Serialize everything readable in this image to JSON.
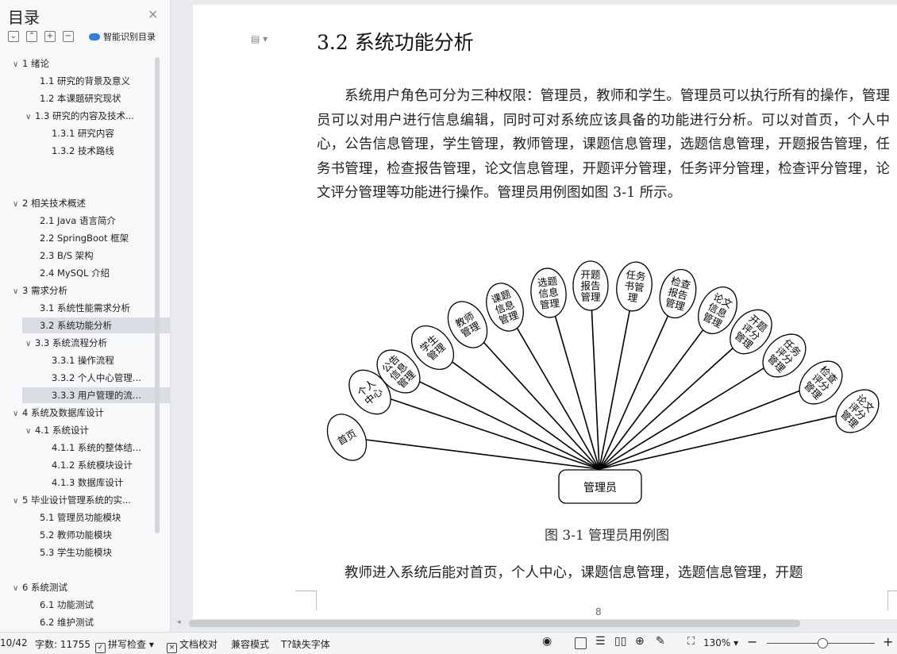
{
  "sidebar": {
    "title": "目录",
    "close": "×",
    "tool_icons": [
      "⌄",
      "⌃",
      "+",
      "−"
    ],
    "smart_label": "智能识别目录",
    "items": [
      {
        "text": "1 绪论",
        "level": 0,
        "arrow": "∨"
      },
      {
        "text": "1.1 研究的背景及意义",
        "level": 1
      },
      {
        "text": "1.2 本课题研究现状",
        "level": 1
      },
      {
        "text": "1.3 研究的内容及技术...",
        "level": 1,
        "arrow": "∨"
      },
      {
        "text": "1.3.1 研究内容",
        "level": 2
      },
      {
        "text": "1.3.2 技术路线",
        "level": 2
      },
      {
        "text": "2 相关技术概述",
        "level": 0,
        "arrow": "∨"
      },
      {
        "text": "2.1 Java 语言简介",
        "level": 1
      },
      {
        "text": "2.2 SpringBoot 框架",
        "level": 1
      },
      {
        "text": "2.3 B/S 架构",
        "level": 1
      },
      {
        "text": "2.4 MySQL 介绍",
        "level": 1
      },
      {
        "text": "3 需求分析",
        "level": 0,
        "arrow": "∨"
      },
      {
        "text": "3.1 系统性能需求分析",
        "level": 1
      },
      {
        "text": "3.2 系统功能分析",
        "level": 1,
        "selected": true
      },
      {
        "text": "3.3 系统流程分析",
        "level": 1,
        "arrow": "∨"
      },
      {
        "text": "3.3.1 操作流程",
        "level": 2
      },
      {
        "text": "3.3.2 个人中心管理...",
        "level": 2
      },
      {
        "text": "3.3.3 用户管理的流...",
        "level": 2,
        "selected": true
      },
      {
        "text": "4 系统及数据库设计",
        "level": 0,
        "arrow": "∨"
      },
      {
        "text": "4.1 系统设计",
        "level": 1,
        "arrow": "∨"
      },
      {
        "text": "4.1.1 系统的整体结...",
        "level": 2
      },
      {
        "text": "4.1.2 系统模块设计",
        "level": 2
      },
      {
        "text": "4.1.3 数据库设计",
        "level": 2
      },
      {
        "text": "5 毕业设计管理系统的实...",
        "level": 0,
        "arrow": "∨"
      },
      {
        "text": "5.1 管理员功能模块",
        "level": 1
      },
      {
        "text": "5.2 教师功能模块",
        "level": 1
      },
      {
        "text": "5.3 学生功能模块",
        "level": 1
      },
      {
        "text": "6 系统测试",
        "level": 0,
        "arrow": "∨"
      },
      {
        "text": "6.1 功能测试",
        "level": 1
      },
      {
        "text": "6.2 维护测试",
        "level": 1
      }
    ]
  },
  "document": {
    "page_icon": "▤ ▾",
    "heading": "3.2 系统功能分析",
    "paragraph": "系统用户角色可分为三种权限：管理员，教师和学生。管理员可以执行所有的操作，管理员可以对用户进行信息编辑，同时可对系统应该具备的功能进行分析。可以对首页，个人中心，公告信息管理，学生管理，教师管理，课题信息管理，选题信息管理，开题报告管理，任务书管理，检查报告管理，论文信息管理，开题评分管理，任务评分管理，检查评分管理，论文评分管理等功能进行操作。管理员用例图如图 3-1 所示。",
    "figure_caption": "图 3-1 管理员用例图",
    "paragraph2": "教师进入系统后能对首页，个人中心，课题信息管理，选题信息管理，开题",
    "page_number": "8"
  },
  "diagram": {
    "center": "管理员",
    "nodes": [
      {
        "lines": [
          "首页"
        ]
      },
      {
        "lines": [
          "个人",
          "中心"
        ]
      },
      {
        "lines": [
          "公告",
          "信息",
          "管理"
        ]
      },
      {
        "lines": [
          "学生",
          "管理"
        ]
      },
      {
        "lines": [
          "教师",
          "管理"
        ]
      },
      {
        "lines": [
          "课题",
          "信息",
          "管理"
        ]
      },
      {
        "lines": [
          "选题",
          "信息",
          "管理"
        ]
      },
      {
        "lines": [
          "开题",
          "报告",
          "管理"
        ]
      },
      {
        "lines": [
          "任务",
          "书管",
          "理"
        ]
      },
      {
        "lines": [
          "检查",
          "报告",
          "管理"
        ]
      },
      {
        "lines": [
          "论文",
          "信息",
          "管理"
        ]
      },
      {
        "lines": [
          "开题",
          "评分",
          "管理"
        ]
      },
      {
        "lines": [
          "任务",
          "评分",
          "管理"
        ]
      },
      {
        "lines": [
          "检查",
          "评分",
          "管理"
        ]
      },
      {
        "lines": [
          "论文",
          "评分",
          "管理"
        ]
      }
    ]
  },
  "statusbar": {
    "page": "10/42",
    "word_count": "字数: 11755",
    "spell": "拼写检查 ▾",
    "doc_check": "文档校对",
    "compat": "兼容模式",
    "missing_font": "缺失字体",
    "zoom": "130% ▾",
    "minus": "−",
    "plus": "+"
  }
}
